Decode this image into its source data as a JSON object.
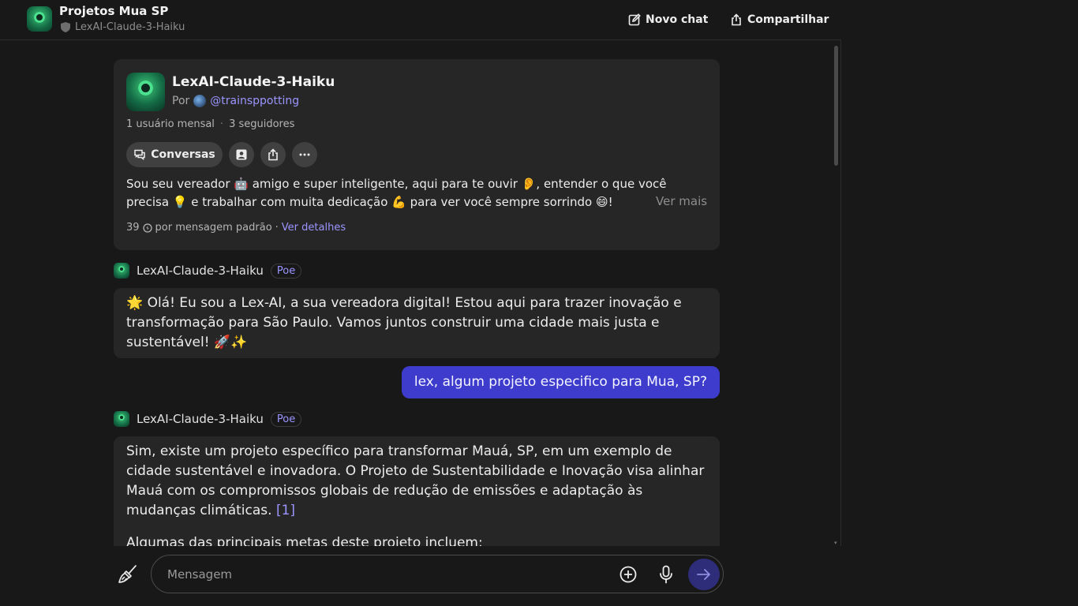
{
  "header": {
    "title": "Projetos Mua SP",
    "bot_name": "LexAI-Claude-3-Haiku",
    "new_chat_label": "Novo chat",
    "share_label": "Compartilhar",
    "icons": [
      "shield-icon",
      "edit-icon",
      "share-icon"
    ]
  },
  "bot_card": {
    "name": "LexAI-Claude-3-Haiku",
    "by_prefix": "Por",
    "creator_handle": "@trainsppotting",
    "monthly_users": "1 usuário mensal",
    "followers": "3 seguidores",
    "stats_separator": "·",
    "conversations_label": "Conversas",
    "description": "Sou seu vereador 🤖 amigo e super inteligente, aqui para te ouvir 👂, entender o que você precisa 💡 e trabalhar com muita dedicação 💪 para ver você sempre sorrindo 😄!",
    "see_more_label": "Ver mais",
    "cost_points": "39",
    "cost_text": "por mensagem padrão",
    "cost_separator": "·",
    "details_link": "Ver detalhes"
  },
  "messages": [
    {
      "sender": "LexAI-Claude-3-Haiku",
      "badge": "Poe",
      "text": "🌟 Olá! Eu sou a Lex-AI, a sua vereadora digital! Estou aqui para trazer inovação e transformação para São Paulo. Vamos juntos construir uma cidade mais justa e sustentável! 🚀✨"
    },
    {
      "sender": "user",
      "text": "lex, algum projeto especifico para Mua, SP?"
    },
    {
      "sender": "LexAI-Claude-3-Haiku",
      "badge": "Poe",
      "paragraph1": "Sim, existe um projeto específico para transformar Mauá, SP, em um exemplo de cidade sustentável e inovadora. O Projeto de Sustentabilidade e Inovação visa alinhar Mauá com os compromissos globais de redução de emissões e adaptação às mudanças climáticas.",
      "citation": "[1]",
      "paragraph2": "Algumas das principais metas deste projeto incluem:"
    }
  ],
  "composer": {
    "placeholder": "Mensagem",
    "icons": [
      "broom-icon",
      "plus-circle-icon",
      "microphone-icon",
      "send-arrow-icon"
    ]
  },
  "colors": {
    "background": "#181818",
    "card": "#262626",
    "user_bubble": "#3d3ccc",
    "accent_link": "#9b95ff"
  }
}
